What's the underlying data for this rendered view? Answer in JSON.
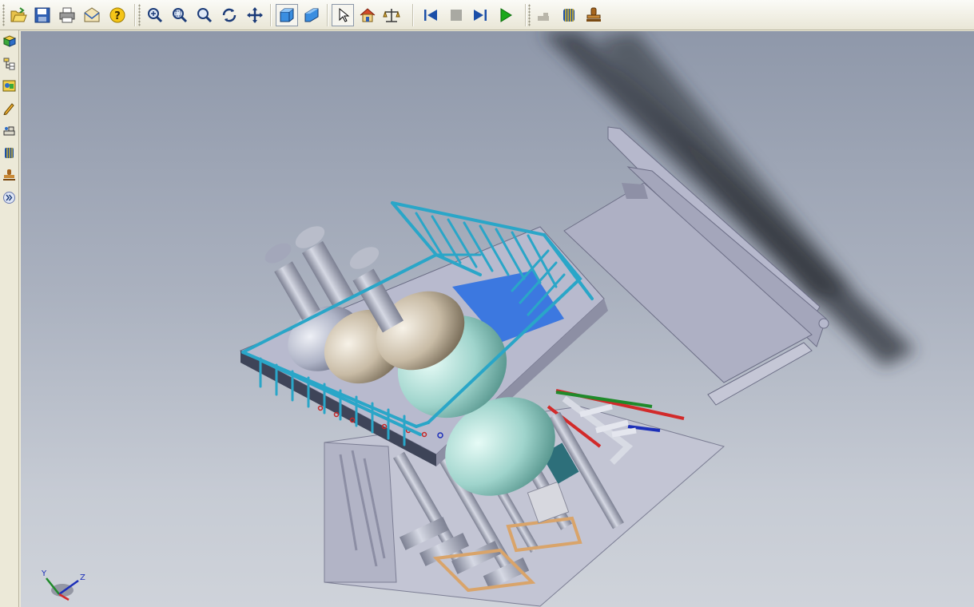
{
  "toolbar": {
    "groups": [
      [
        "open-icon",
        "save-icon",
        "print-icon",
        "send-icon",
        "help-icon"
      ],
      [
        "zoom-window-icon",
        "zoom-in-out-icon",
        "zoom-fit-icon",
        "rotate-icon",
        "pan-icon"
      ],
      [
        "shaded-view-icon",
        "perspective-view-icon"
      ],
      [
        "select-icon",
        "home-view-icon",
        "measure-icon"
      ],
      [
        "first-step-icon",
        "stop-icon",
        "next-step-icon",
        "play-icon"
      ],
      [
        "explode-icon",
        "section-icon",
        "stamp-icon"
      ]
    ]
  },
  "sidebar": {
    "items": [
      "assembly-icon",
      "tree-icon",
      "properties-icon",
      "markup-icon",
      "explode-icon",
      "section-icon",
      "stamp-icon",
      "expand-icon"
    ]
  },
  "viewport": {
    "triad_labels": {
      "x": "X",
      "y": "Y",
      "z": "Z"
    },
    "colors": {
      "railing": "#2aa6c8",
      "deck_blue": "#3c78e0",
      "frame": "#a9abc0",
      "vessel_silver": "#b9bdca",
      "vessel_beige": "#c9bfae",
      "vessel_teal": "#9fd4cc"
    }
  }
}
